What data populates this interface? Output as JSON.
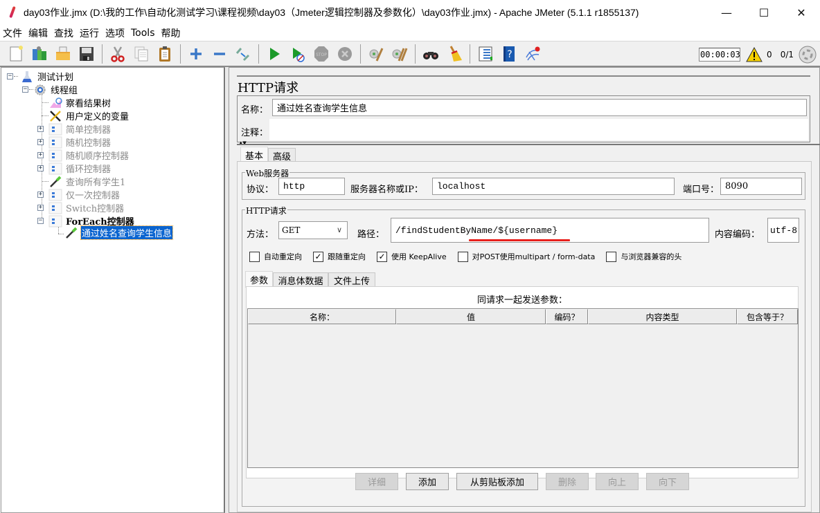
{
  "window": {
    "title": "day03作业.jmx (D:\\我的工作\\自动化测试学习\\课程视频\\day03（Jmeter逻辑控制器及参数化）\\day03作业.jmx) - Apache JMeter (5.1.1 r1855137)",
    "minimize": "—",
    "maximize": "☐",
    "close": "✕"
  },
  "menu": [
    "文件",
    "编辑",
    "查找",
    "运行",
    "选项",
    "Tools",
    "帮助"
  ],
  "toolbar": {
    "buttons": [
      "new",
      "templates",
      "open",
      "save",
      "cut",
      "copy",
      "paste",
      "expand-all",
      "collapse-all",
      "toggle",
      "start",
      "start-no-pauses",
      "stop",
      "shutdown",
      "clear",
      "clear-all",
      "search",
      "reset-search",
      "function-helper",
      "help",
      "remote-start-all"
    ],
    "timer": "00:00:03",
    "warning_count": "0",
    "threads": "0/1"
  },
  "tree": {
    "nodes": [
      {
        "label": "测试计划",
        "icon": "flask-icon",
        "level": 0,
        "expander": "minus",
        "state": "normal"
      },
      {
        "label": "线程组",
        "icon": "gear-icon",
        "level": 1,
        "expander": "minus",
        "state": "normal"
      },
      {
        "label": "察看结果树",
        "icon": "chart-icon",
        "level": 2,
        "expander": "none",
        "state": "normal"
      },
      {
        "label": "用户定义的变量",
        "icon": "tools-icon",
        "level": 2,
        "expander": "none",
        "state": "normal"
      },
      {
        "label": "简单控制器",
        "icon": "controller-icon",
        "level": 2,
        "expander": "plus",
        "state": "disabled"
      },
      {
        "label": "随机控制器",
        "icon": "controller-icon",
        "level": 2,
        "expander": "plus",
        "state": "disabled"
      },
      {
        "label": "随机顺序控制器",
        "icon": "controller-icon",
        "level": 2,
        "expander": "plus",
        "state": "disabled"
      },
      {
        "label": "循环控制器",
        "icon": "controller-icon",
        "level": 2,
        "expander": "plus",
        "state": "disabled"
      },
      {
        "label": "查询所有学生1",
        "icon": "pipette-icon",
        "level": 2,
        "expander": "none",
        "state": "disabled"
      },
      {
        "label": "仅一次控制器",
        "icon": "controller-icon",
        "level": 2,
        "expander": "plus",
        "state": "disabled"
      },
      {
        "label": "Switch控制器",
        "icon": "controller-icon",
        "level": 2,
        "expander": "plus",
        "state": "disabled"
      },
      {
        "label": "ForEach控制器",
        "icon": "controller-icon",
        "level": 2,
        "expander": "minus",
        "state": "bold"
      },
      {
        "label": "通过姓名查询学生信息",
        "icon": "pipette-icon",
        "level": 3,
        "expander": "none",
        "state": "selected"
      }
    ]
  },
  "panel": {
    "title": "HTTP请求",
    "name_label": "名称：",
    "name_value": "通过姓名查询学生信息",
    "comment_label": "注释：",
    "comment_value": "",
    "tabs": [
      "基本",
      "高级"
    ],
    "active_tab": "基本",
    "web_server": {
      "title": "Web服务器",
      "protocol_label": "协议：",
      "protocol_value": "http",
      "server_label": "服务器名称或IP：",
      "server_value": "localhost",
      "port_label": "端口号：",
      "port_value": "8090"
    },
    "http_request": {
      "title": "HTTP请求",
      "method_label": "方法：",
      "method_value": "GET",
      "path_label": "路径：",
      "path_value": "/findStudentByName/${username}",
      "encoding_label": "内容编码：",
      "encoding_value": "utf-8",
      "checkboxes": [
        {
          "label": "自动重定向",
          "checked": false
        },
        {
          "label": "跟随重定向",
          "checked": true
        },
        {
          "label": "使用 KeepAlive",
          "checked": true
        },
        {
          "label": "对POST使用multipart / form-data",
          "checked": false
        },
        {
          "label": "与浏览器兼容的头",
          "checked": false
        }
      ]
    },
    "sub_tabs": [
      "参数",
      "消息体数据",
      "文件上传"
    ],
    "active_sub_tab": "参数",
    "params_caption": "同请求一起发送参数：",
    "table_headers": [
      "名称：",
      "值",
      "编码？",
      "内容类型",
      "包含等于？"
    ],
    "table_rows": [],
    "buttons": [
      {
        "label": "详细",
        "enabled": false
      },
      {
        "label": "添加",
        "enabled": true
      },
      {
        "label": "从剪贴板添加",
        "enabled": true
      },
      {
        "label": "删除",
        "enabled": false
      },
      {
        "label": "向上",
        "enabled": false
      },
      {
        "label": "向下",
        "enabled": false
      }
    ],
    "annotation_color": "#e8201c"
  }
}
